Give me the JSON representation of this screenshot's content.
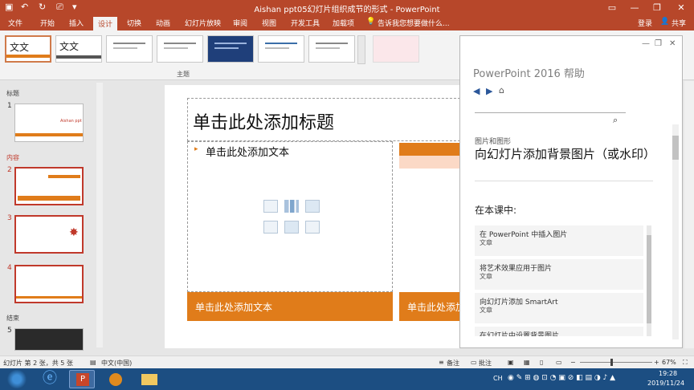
{
  "window": {
    "title": "Aishan ppt05幻灯片组织成节的形式 - PowerPoint",
    "login": "登录",
    "share": "共享"
  },
  "tabs": [
    "文件",
    "开始",
    "插入",
    "设计",
    "切换",
    "动画",
    "幻灯片放映",
    "审阅",
    "视图",
    "开发工具",
    "加载项"
  ],
  "active_tab": "设计",
  "tell_me": "告诉我您想要做什么...",
  "ribbon": {
    "group_label": "主题",
    "theme_label": "文文"
  },
  "thumbnails": {
    "sections": [
      "标题",
      "内容",
      "结束"
    ],
    "thumb1_title": "Aishan ppt"
  },
  "slide": {
    "title_placeholder": "单击此处添加标题",
    "bullet_placeholder": "单击此处添加文本",
    "footer_left": "单击此处添加文本",
    "footer_right": "单击此处添加文本"
  },
  "help": {
    "title": "PowerPoint 2016 帮助",
    "category": "图片和图形",
    "heading": "向幻灯片添加背景图片（或水印）",
    "in_lesson": "在本课中:",
    "items": [
      {
        "title": "在 PowerPoint 中插入图片",
        "kind": "文章"
      },
      {
        "title": "将艺术效果应用于图片",
        "kind": "文章"
      },
      {
        "title": "向幻灯片添加 SmartArt",
        "kind": "文章"
      },
      {
        "title": "在幻灯片中设置背景图片",
        "kind": ""
      }
    ]
  },
  "status": {
    "slide_info": "幻灯片 第 2 张，共 5 张",
    "language": "中文(中国)",
    "notes": "备注",
    "comments": "批注",
    "zoom": "67%"
  },
  "taskbar": {
    "ime": "CH",
    "time": "19:28",
    "date": "2019/11/24"
  },
  "colors": {
    "brand": "#b7472a",
    "orange": "#e07c1a",
    "selected_thumb": "#c0392b"
  }
}
